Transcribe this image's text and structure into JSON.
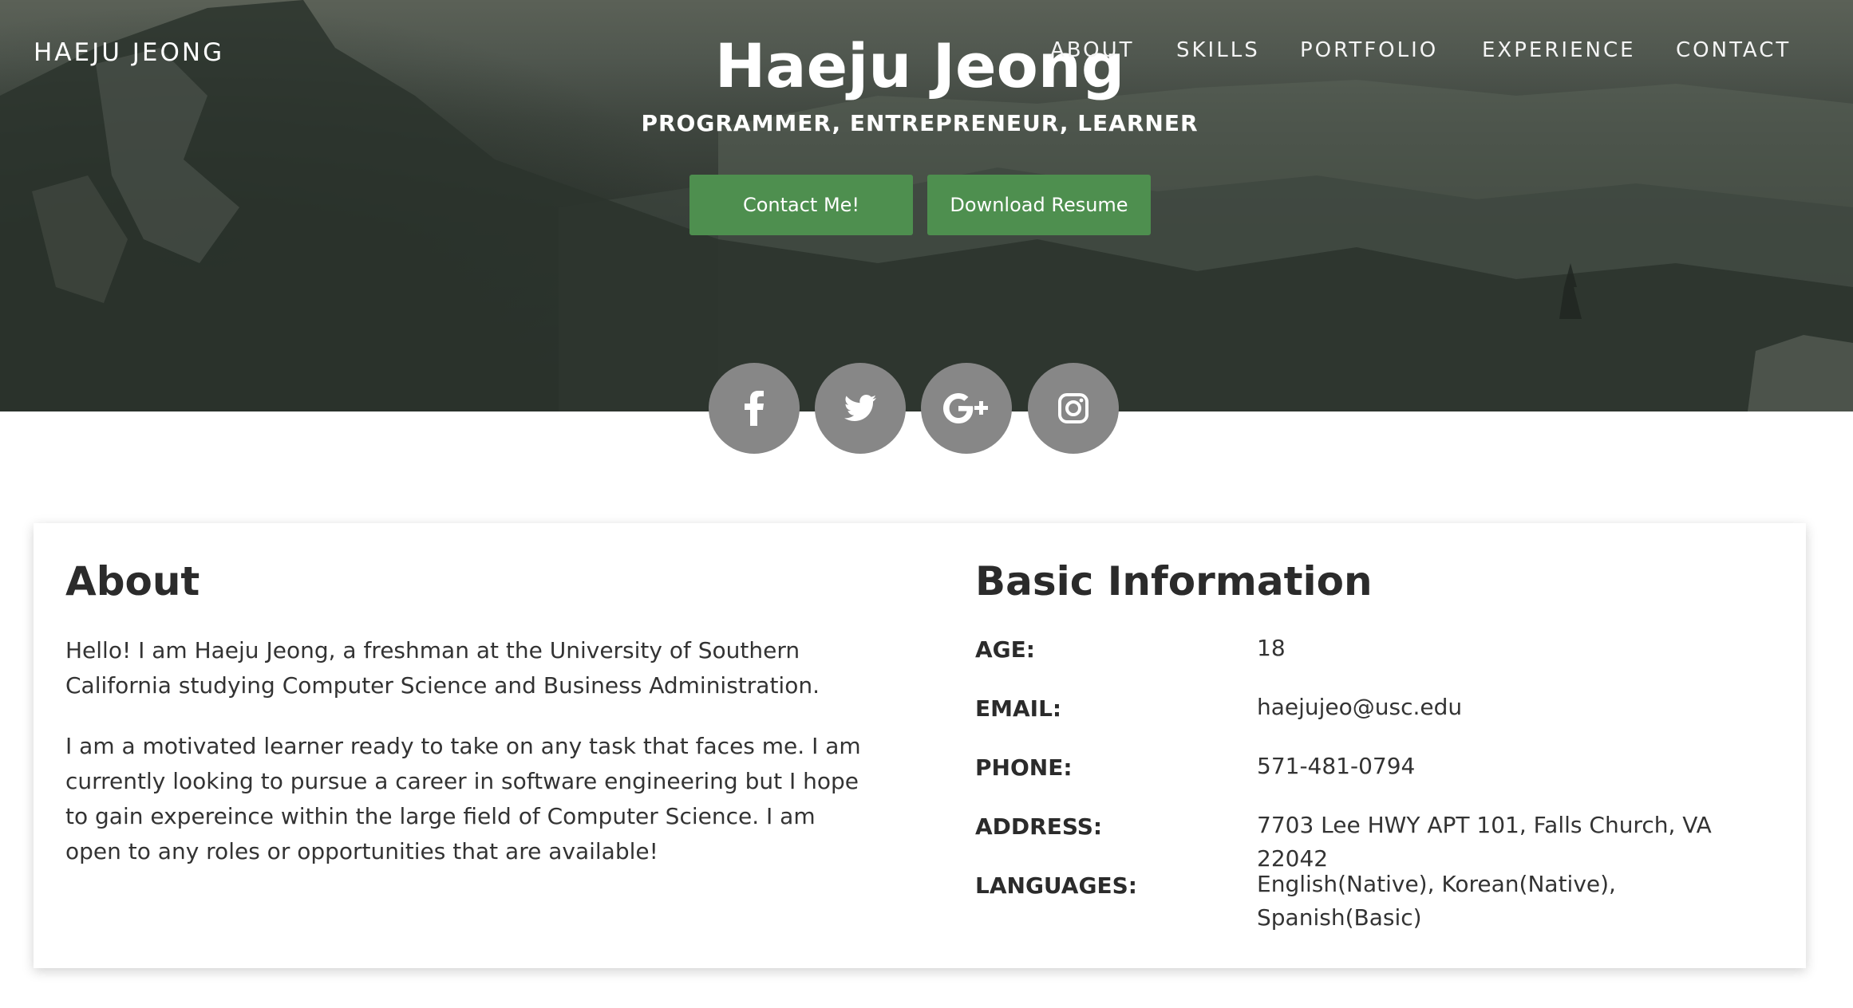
{
  "brand": "HAEJU JEONG",
  "nav": {
    "items": [
      {
        "label": "ABOUT"
      },
      {
        "label": "SKILLS"
      },
      {
        "label": "PORTFOLIO"
      },
      {
        "label": "EXPERIENCE"
      },
      {
        "label": "CONTACT"
      }
    ]
  },
  "hero": {
    "title": "Haeju Jeong",
    "subtitle": "PROGRAMMER, ENTREPRENEUR, LEARNER",
    "contact_button": "Contact Me!",
    "resume_button": "Download Resume"
  },
  "social": [
    {
      "icon": "facebook-icon"
    },
    {
      "icon": "twitter-icon"
    },
    {
      "icon": "google-plus-icon"
    },
    {
      "icon": "instagram-icon"
    }
  ],
  "about": {
    "heading": "About",
    "paragraphs": [
      "Hello! I am Haeju Jeong, a freshman at the University of Southern California studying Computer Science and Business Administration.",
      "I am a motivated learner ready to take on any task that faces me. I am currently looking to pursue a career in software engineering but I hope to gain expereince within the large field of Computer Science. I am open to any roles or opportunities that are available!"
    ]
  },
  "basic_info": {
    "heading": "Basic Information",
    "rows": [
      {
        "label": "AGE:",
        "value": "18"
      },
      {
        "label": "EMAIL:",
        "value": "haejujeo@usc.edu"
      },
      {
        "label": "PHONE:",
        "value": "571-481-0794"
      },
      {
        "label": "ADDRESS:",
        "value": "7703 Lee HWY APT 101, Falls Church, VA 22042"
      },
      {
        "label": "LANGUAGES:",
        "value": "English(Native), Korean(Native), Spanish(Basic)"
      }
    ]
  },
  "colors": {
    "button_green": "#4e8f4f",
    "social_gray": "#878787",
    "heading_dark": "#2b2b2b"
  }
}
